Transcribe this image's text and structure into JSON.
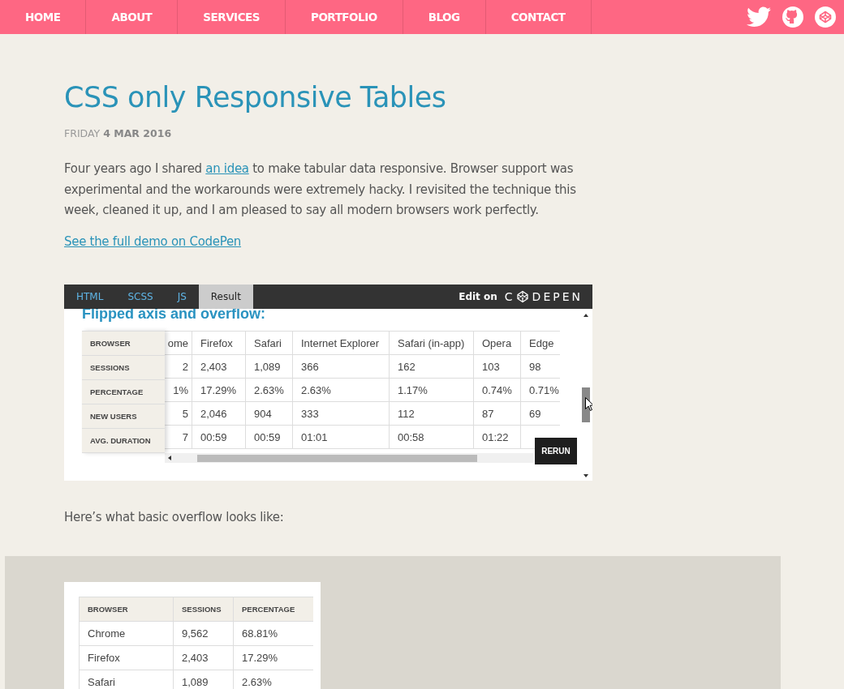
{
  "nav": {
    "items": [
      {
        "label": "HOME"
      },
      {
        "label": "ABOUT"
      },
      {
        "label": "SERVICES"
      },
      {
        "label": "PORTFOLIO"
      },
      {
        "label": "BLOG"
      },
      {
        "label": "CONTACT"
      }
    ]
  },
  "article": {
    "title": "CSS only Responsive Tables",
    "date": {
      "day": "FRIDAY",
      "date": "4 MAR 2016"
    },
    "intro": {
      "before": "Four years ago I shared ",
      "link": "an idea",
      "after": " to make tabular data responsive. Browser support was experimental and the workarounds were extremely hacky. I revisited the technique this week, cleaned it up, and I am pleased to say all modern browsers work perfectly."
    },
    "demo_link": "See the full demo on CodePen",
    "embed": {
      "tabs": [
        {
          "label": "HTML",
          "selected": false
        },
        {
          "label": "SCSS",
          "selected": false
        },
        {
          "label": "JS",
          "selected": false
        },
        {
          "label": "Result",
          "selected": true
        }
      ],
      "edit_label": "Edit on",
      "brand": [
        "C",
        "DEPEN"
      ],
      "heading": "Flipped axis and overflow:",
      "rows": [
        {
          "header": "BROWSER",
          "cells": [
            "ome",
            "Firefox",
            "Safari",
            "Internet Explorer",
            "Safari (in-app)",
            "Opera",
            "Edge"
          ]
        },
        {
          "header": "SESSIONS",
          "cells": [
            "2",
            "2,403",
            "1,089",
            "366",
            "162",
            "103",
            "98"
          ]
        },
        {
          "header": "PERCENTAGE",
          "cells": [
            "1%",
            "17.29%",
            "2.63%",
            "2.63%",
            "1.17%",
            "0.74%",
            "0.71%"
          ]
        },
        {
          "header": "NEW USERS",
          "cells": [
            "5",
            "2,046",
            "904",
            "333",
            "112",
            "87",
            "69"
          ]
        },
        {
          "header": "AVG. DURATION",
          "cells": [
            "7",
            "00:59",
            "00:59",
            "01:01",
            "00:58",
            "01:22"
          ]
        }
      ],
      "rerun": "RERUN"
    },
    "overflow_text": "Here’s what basic overflow looks like:",
    "basic_table": {
      "columns": [
        "BROWSER",
        "SESSIONS",
        "PERCENTAGE"
      ],
      "rows": [
        [
          "Chrome",
          "9,562",
          "68.81%"
        ],
        [
          "Firefox",
          "2,403",
          "17.29%"
        ],
        [
          "Safari",
          "1,089",
          "2.63%"
        ]
      ]
    }
  }
}
